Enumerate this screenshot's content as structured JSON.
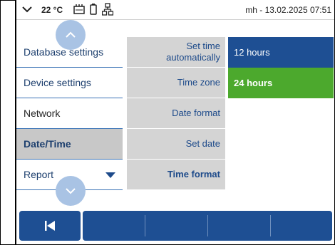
{
  "statusbar": {
    "temperature": "22 °C",
    "device_time": "mh - 13.02.2025 07:51",
    "icons": [
      "chevron-down-icon",
      "memory-icon",
      "battery-icon",
      "network-icon"
    ]
  },
  "menu": {
    "items": [
      {
        "label": "Database settings"
      },
      {
        "label": "Device settings"
      },
      {
        "label": "Network"
      },
      {
        "label": "Date/Time",
        "active": true
      },
      {
        "label": "Report"
      }
    ]
  },
  "submenu": {
    "items": [
      {
        "label": "Set time automatically"
      },
      {
        "label": "Time zone"
      },
      {
        "label": "Date format"
      },
      {
        "label": "Set date"
      },
      {
        "label": "Time format",
        "selected": true
      }
    ]
  },
  "options": {
    "items": [
      {
        "label": "12 hours"
      },
      {
        "label": "24 hours",
        "selected": true
      }
    ]
  },
  "toolbar": {
    "back_icon": "skip-back-icon",
    "slots": 4
  },
  "colors": {
    "accent": "#1e4f93",
    "selected": "#4ca92d",
    "scroll_button": "#a9c3e4",
    "active_menu": "#c8c8c8"
  }
}
